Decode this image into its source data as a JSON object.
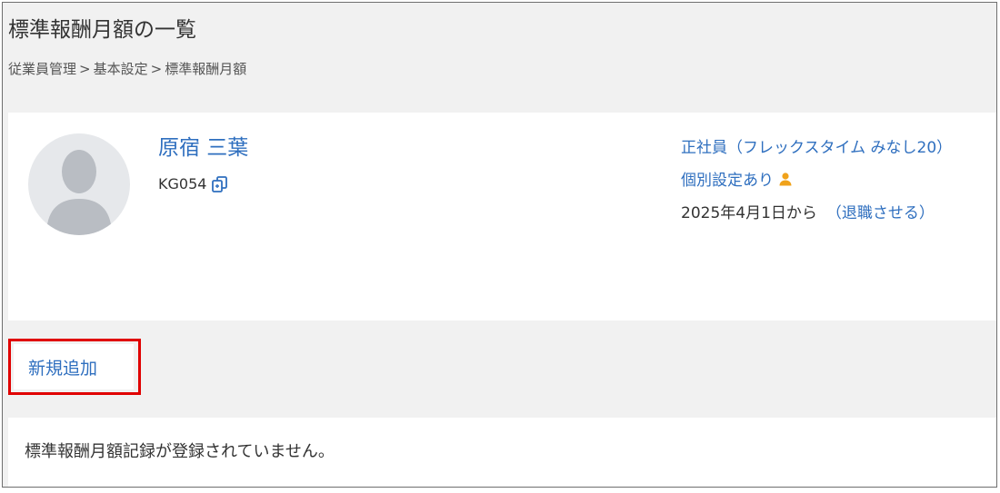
{
  "page": {
    "title": "標準報酬月額の一覧",
    "breadcrumb": [
      "従業員管理",
      "基本設定",
      "標準報酬月額"
    ],
    "breadcrumb_separator": ">"
  },
  "employee": {
    "name": "原宿 三葉",
    "code": "KG054",
    "employment_type": "正社員（フレックスタイム みなし20）",
    "individual_setting": "個別設定あり",
    "start_date": "2025年4月1日から",
    "retire_link": "（退職させる）",
    "icons": {
      "avatar": "avatar-placeholder",
      "copy": "copy-icon",
      "person": "person-icon"
    }
  },
  "actions": {
    "add_label": "新規追加"
  },
  "records": {
    "empty_message": "標準報酬月額記録が登録されていません。"
  },
  "colors": {
    "link": "#2f6fbf",
    "highlight": "#e00000",
    "person_icon": "#f0a21a",
    "background": "#f1f1f1"
  }
}
